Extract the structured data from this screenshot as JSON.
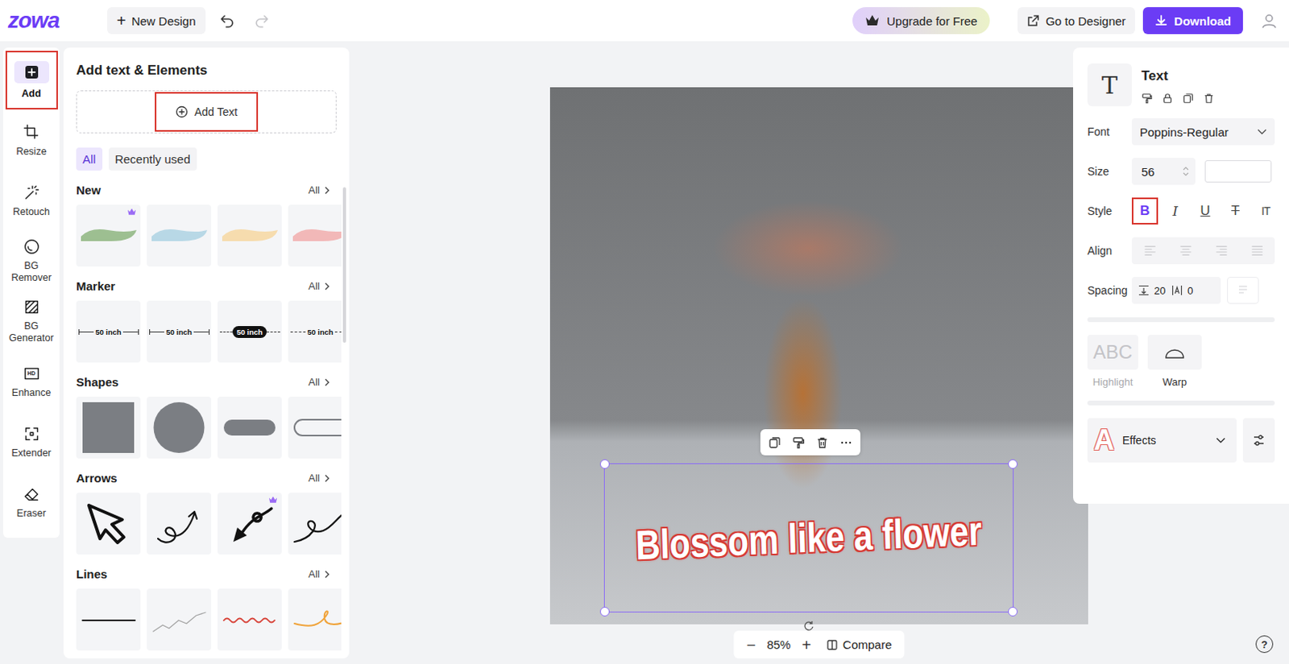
{
  "app": {
    "logo": "zowa"
  },
  "topbar": {
    "new_design": {
      "glyph": "+",
      "label": "New Design"
    },
    "undo": {
      "disabled": false
    },
    "redo": {
      "disabled": true
    },
    "upgrade": "Upgrade for Free",
    "go_to_designer": "Go to Designer",
    "download": "Download"
  },
  "rail": [
    {
      "label": "Add",
      "selected": true,
      "annotated": true
    },
    {
      "label": "Resize",
      "selected": false,
      "annotated": false
    },
    {
      "label": "Retouch",
      "selected": false,
      "annotated": false
    },
    {
      "label": "BG Remover",
      "selected": false,
      "annotated": false
    },
    {
      "label": "BG Generator",
      "selected": false,
      "annotated": false
    },
    {
      "label": "Enhance",
      "selected": false,
      "annotated": false,
      "icon_text": "HD"
    },
    {
      "label": "Extender",
      "selected": false,
      "annotated": false
    },
    {
      "label": "Eraser",
      "selected": false,
      "annotated": false
    }
  ],
  "panel": {
    "title": "Add text & Elements",
    "add_text": {
      "label": "Add Text",
      "annotated": true
    },
    "filters": [
      {
        "label": "All",
        "selected": true
      },
      {
        "label": "Recently used",
        "selected": false
      }
    ],
    "sections": [
      {
        "title": "New",
        "all": "All",
        "kind": "brush",
        "items": [
          {
            "premium": true,
            "color": "#9dbf91"
          },
          {
            "premium": false,
            "color": "#b8d8e6"
          },
          {
            "premium": false,
            "color": "#f6dcae"
          },
          {
            "premium": false,
            "color": "#f2b8b8"
          }
        ]
      },
      {
        "title": "Marker",
        "all": "All",
        "kind": "marker",
        "items": [
          {
            "premium": false,
            "text": "50 inch"
          },
          {
            "premium": false,
            "text": "50 inch"
          },
          {
            "premium": false,
            "text": "50 inch"
          },
          {
            "premium": false,
            "text": "50 inch"
          }
        ]
      },
      {
        "title": "Shapes",
        "all": "All",
        "kind": "shape",
        "items": [
          {
            "premium": false
          },
          {
            "premium": false
          },
          {
            "premium": false
          },
          {
            "premium": false
          }
        ]
      },
      {
        "title": "Arrows",
        "all": "All",
        "kind": "arrow",
        "items": [
          {
            "premium": false
          },
          {
            "premium": false
          },
          {
            "premium": true
          },
          {
            "premium": false
          }
        ]
      },
      {
        "title": "Lines",
        "all": "All",
        "kind": "line",
        "items": [
          {
            "premium": false,
            "color": "#222222"
          },
          {
            "premium": false,
            "color": "#a3a3a3"
          },
          {
            "premium": false,
            "color": "#d8453b"
          },
          {
            "premium": false,
            "color": "#f0a33a"
          }
        ]
      }
    ]
  },
  "canvas": {
    "text_layer": "Blossom like a flower",
    "text_selected": true,
    "zoom_out": "−",
    "zoom": "85%",
    "zoom_in": "+",
    "compare": "Compare",
    "help": "?"
  },
  "properties": {
    "icon_glyph": "T",
    "title": "Text",
    "font": {
      "label": "Font",
      "value": "Poppins-Regular"
    },
    "size": {
      "label": "Size",
      "value": "56"
    },
    "style": {
      "label": "Style",
      "buttons": [
        {
          "kind": "bold",
          "glyph": "B",
          "selected": true,
          "annotated": true
        },
        {
          "kind": "italic",
          "glyph": "I",
          "selected": false,
          "annotated": false
        },
        {
          "kind": "underline",
          "glyph": "U",
          "selected": false,
          "annotated": false
        },
        {
          "kind": "strike",
          "glyph": "T",
          "selected": false,
          "annotated": false
        },
        {
          "kind": "vertical",
          "glyph": "IT",
          "selected": false,
          "annotated": false
        }
      ]
    },
    "align": {
      "label": "Align",
      "disabled": true
    },
    "spacing": {
      "label": "Spacing",
      "line_height": "20",
      "letter": "0"
    },
    "highlight": {
      "label": "Highlight",
      "sample": "ABC",
      "disabled": true
    },
    "warp": {
      "label": "Warp"
    },
    "effects": {
      "label": "Effects",
      "glyph": "A"
    }
  }
}
